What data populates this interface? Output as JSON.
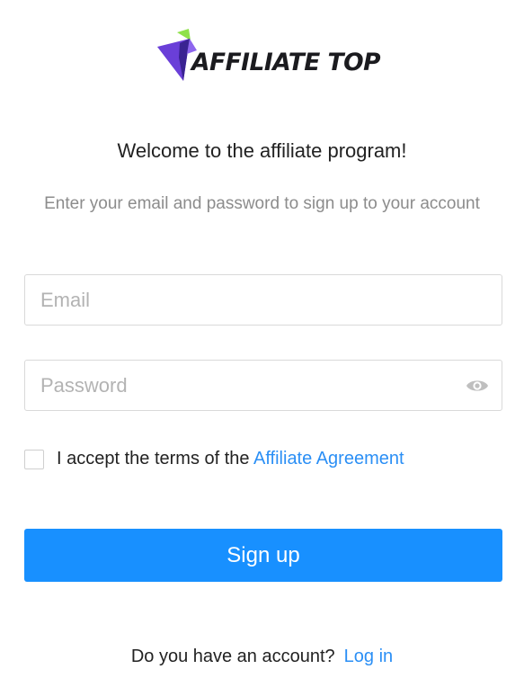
{
  "brand": {
    "logo_text": "AFFILIATE TOP",
    "logo_icon": "arrow-logo-icon",
    "colors": {
      "purple": "#6a3fd8",
      "purple_dark": "#3a2392",
      "green": "#8fe14a"
    }
  },
  "heading": {
    "title": "Welcome to the affiliate program!",
    "subtitle": "Enter your email and password to sign up to your account"
  },
  "form": {
    "email_placeholder": "Email",
    "email_value": "",
    "password_placeholder": "Password",
    "password_value": "",
    "password_toggle_icon": "eye-icon",
    "terms_checked": false,
    "terms_prefix": "I accept the terms of the ",
    "terms_link": "Affiliate Agreement",
    "submit_label": "Sign up"
  },
  "footer": {
    "question": "Do you have an account?",
    "login_link": "Log in"
  },
  "theme": {
    "primary": "#1890ff",
    "link": "#2b8ff5",
    "muted_text": "#8c8c8c",
    "border": "#d9d9d9"
  }
}
